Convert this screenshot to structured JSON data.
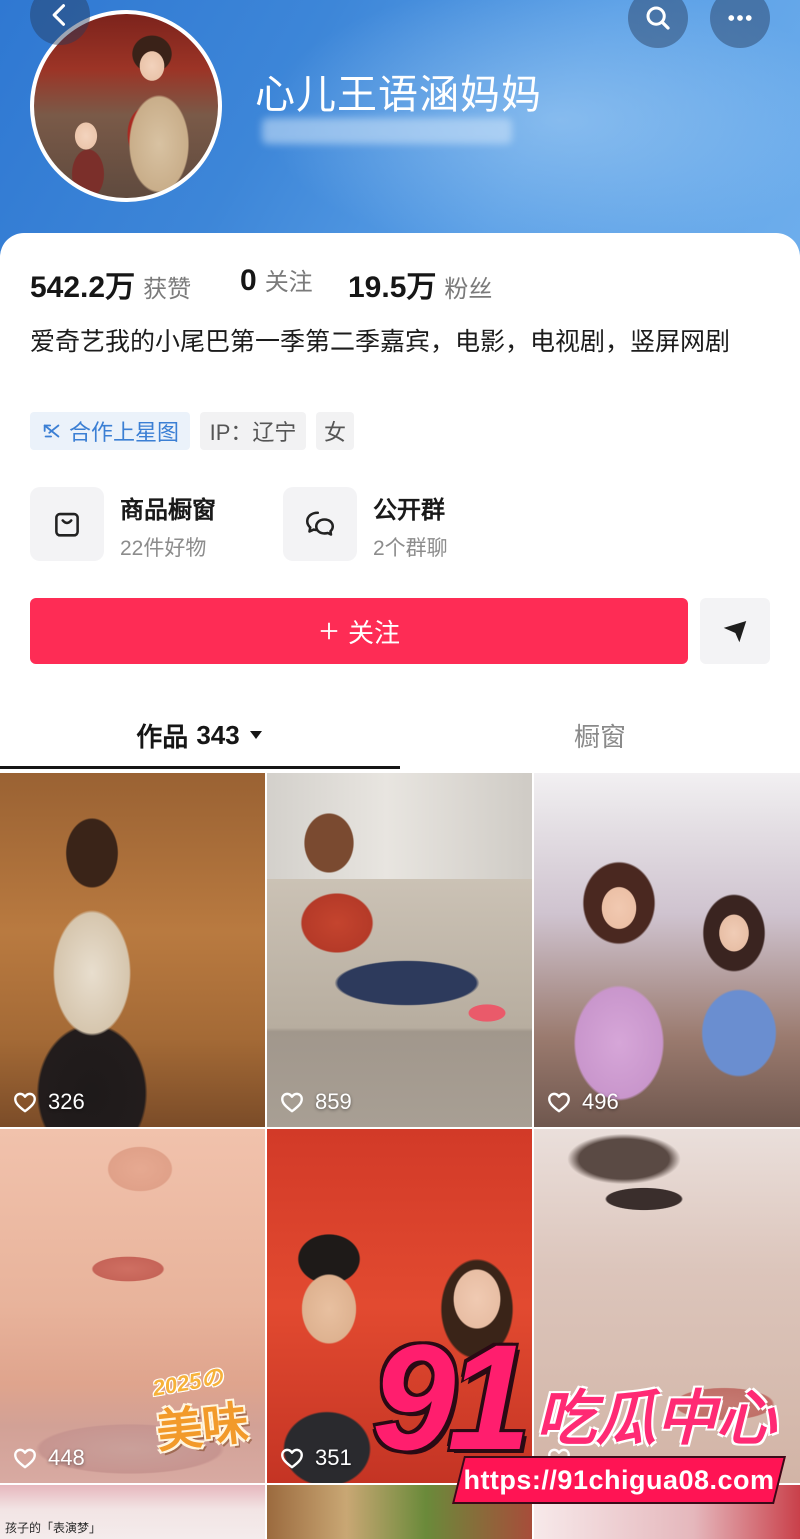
{
  "header": {
    "back_icon": "chevron-left-icon",
    "search_icon": "search-icon",
    "more_icon": "more-dots-icon"
  },
  "profile": {
    "name": "心儿王语涵妈妈"
  },
  "stats": [
    {
      "value": "542.2万",
      "label": "获赞"
    },
    {
      "value": "0",
      "label": "关注"
    },
    {
      "value": "19.5万",
      "label": "粉丝"
    }
  ],
  "bio": "爱奇艺我的小尾巴第一季第二季嘉宾，电影，电视剧，竖屏网剧",
  "tags": [
    {
      "label": "合作上星图",
      "icon": "star-map-icon"
    },
    {
      "label": "IP：辽宁"
    },
    {
      "label": "女"
    }
  ],
  "features": [
    {
      "title": "商品橱窗",
      "subtitle": "22件好物",
      "icon": "shopping-bag-icon"
    },
    {
      "title": "公开群",
      "subtitle": "2个群聊",
      "icon": "group-chat-icon"
    }
  ],
  "actions": {
    "follow_label": "关注",
    "follow_icon": "plus-icon",
    "share_icon": "share-icon"
  },
  "tabs": [
    {
      "label": "作品",
      "count": "343",
      "icon": "triangle-down-icon",
      "active": true
    },
    {
      "label": "橱窗",
      "active": false
    }
  ],
  "videos": [
    {
      "likes": "326"
    },
    {
      "likes": "859"
    },
    {
      "likes": "496"
    },
    {
      "likes": "448",
      "overlay_year": "2025の",
      "overlay_title": "美味"
    },
    {
      "likes": "351"
    },
    {},
    {
      "caption": "孩子的「表演梦」"
    },
    {},
    {}
  ],
  "watermark": {
    "number": "91",
    "text": "吃瓜中心",
    "url": "https://91chigua08.com"
  },
  "colors": {
    "accent": "#fe2c55",
    "header_blue": "#3d86d8",
    "tag_blue": "#3b7fd4",
    "watermark_pink": "#ff1e6e"
  }
}
